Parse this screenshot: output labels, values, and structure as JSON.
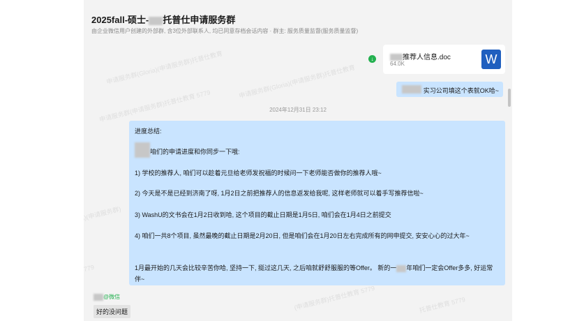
{
  "header": {
    "title": "2025fall-硕士-",
    "title_suffix": "托普仕申请服务群",
    "subtitle": "由企业微信用户创建的外部群, 含3位外部联系人, 均已同意存档会话内容 · 群主: 服务质量监督(服务质量监督)"
  },
  "file_message": {
    "name": "推荐人信息.doc",
    "size": "64.0K",
    "icon": "word-icon",
    "download_icon": "download-icon",
    "icon_letter": "W"
  },
  "right_message": {
    "text": "实习公司填这个表就OK哈~"
  },
  "timestamp": "2024年12月31日 23:12",
  "summary_message": {
    "lines": [
      "进度总结:",
      "咱们的申请进度和你同步一下哦:",
      "1) 学校的推荐人, 咱们可以趁着元旦给老师发祝福的时候问一下老师能否做你的推荐人哦~",
      "2) 今天是不是已经到济南了呀, 1月2日之前把推荐人的信息返发给我呢, 这样老师就可以着手写推荐信啦~",
      "3) WashU的文书会在1月2日收到哈, 这个项目的截止日期是1月5日, 咱们会在1月4日之前提交",
      "4) 咱们一共8个项目, 虽然最晚的截止日期是2月20日, 但是咱们会在1月20日左右完成所有的网申提交, 安安心心的过大年~",
      "1月最开始的几天会比较辛苦你哈, 坚持一下, 挺过这几天, 之后咱就舒舒服服的等Offer。 新的一",
      "年咱们一定会Offer多多, 好运常",
      "伴~"
    ]
  },
  "sender": {
    "tag": "@微信"
  },
  "reply_message": {
    "text": "好的没问题"
  },
  "watermark": "(申请服务群)(Gloria)(申请服务群)托普仕教育 5779",
  "colors": {
    "bubble": "#c9e4ff",
    "panel": "#f3f3f3",
    "word": "#1f5fbf",
    "wechat_green": "#23b04f"
  }
}
